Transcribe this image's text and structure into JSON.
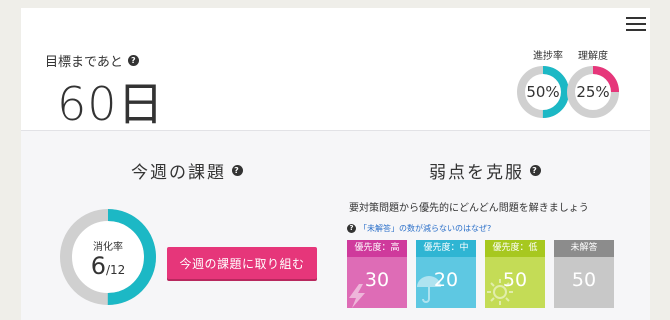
{
  "header": {
    "goal_label": "目標まであと",
    "goal_days": "60日"
  },
  "rings": {
    "progress": {
      "label": "進捗率",
      "value": "50%",
      "fraction": 0.5,
      "color": "#1cb8c5"
    },
    "understanding": {
      "label": "理解度",
      "value": "25%",
      "fraction": 0.25,
      "color": "#e6367a"
    }
  },
  "weekly": {
    "title": "今週の課題",
    "digest_label": "消化率",
    "digest_done": "6",
    "digest_total": "/12",
    "digest_fraction": 0.5,
    "digest_color": "#1cb8c5",
    "button_label": "今週の課題に取り組む"
  },
  "weak": {
    "title": "弱点を克服",
    "description": "要対策問題から優先的にどんどん問題を解きましょう",
    "link_text": "「未解答」の数が減らないのはなぜ?",
    "cards": [
      {
        "label": "優先度：高",
        "count": "30",
        "head_color": "#cf3a9c",
        "body_color": "#de6cb6",
        "icon": "lightning-icon"
      },
      {
        "label": "優先度：中",
        "count": "20",
        "head_color": "#2fb5d3",
        "body_color": "#5ec8e2",
        "icon": "umbrella-icon"
      },
      {
        "label": "優先度：低",
        "count": "50",
        "head_color": "#a7c81f",
        "body_color": "#c4dc56",
        "icon": "sun-icon"
      },
      {
        "label": "未解答",
        "count": "50",
        "head_color": "#8c8c8c",
        "body_color": "#c8c8c8",
        "icon": ""
      }
    ]
  }
}
